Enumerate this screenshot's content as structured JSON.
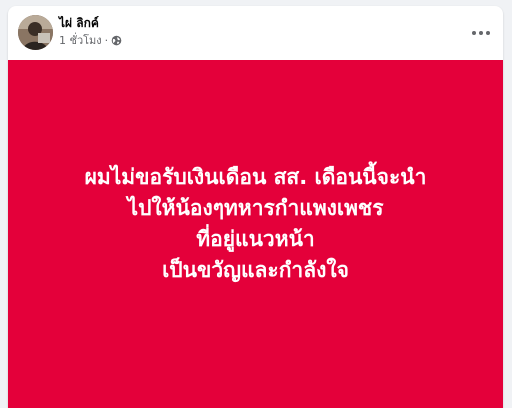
{
  "post": {
    "author_name": "ไผ่ ลิกค์",
    "time": "1 ชั่วโมง",
    "separator": "·",
    "privacy_icon": "globe-icon",
    "more_icon": "more-horizontal-icon"
  },
  "banner": {
    "background_color": "#e4003a",
    "lines": [
      "ผมไม่ขอรับเงินเดือน สส. เดือนนี้จะนำ",
      "ไปให้น้องๆทหารกำแพงเพชร",
      "ที่อยู่แนวหน้า",
      "เป็นขวัญและกำลังใจ"
    ]
  }
}
